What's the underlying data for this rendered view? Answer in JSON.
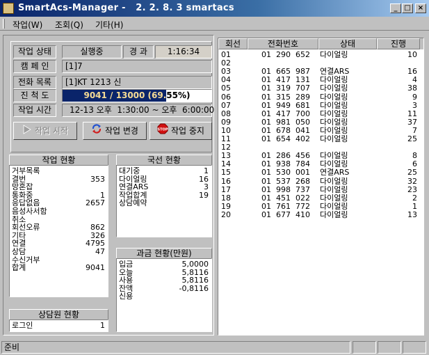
{
  "window": {
    "title": "SmartAcs-Manager -   2. 2. 8. 3 smartacs",
    "minimize": "_",
    "maximize": "□",
    "close": "×"
  },
  "menu": [
    "작업(W)",
    "조회(Q)",
    "기타(H)"
  ],
  "job": {
    "status_label": "작업 상태",
    "status_value": "실행중",
    "elapsed_label": "경 과",
    "elapsed_value": "1:16:34",
    "campaign_label": "캠 페 인",
    "campaign_value": "[1]7",
    "phonelist_label": "전화 목록",
    "phonelist_value": "[1]KT 1213 신",
    "progress_label": "진 척 도",
    "progress_text": "9041 / 13000 (69.55%)",
    "progress_fraction": 0.6955,
    "time_label": "작업 시간",
    "time_value": "12-13 오후  1:30:00 ~ 오후  6:00:00"
  },
  "buttons": {
    "start": "작업 시작",
    "change": "작업 변경",
    "stop": "작업 중지"
  },
  "work_status": {
    "title": "작업 현황",
    "rows": [
      {
        "k": "거부목록",
        "v": ""
      },
      {
        "k": "결번",
        "v": "353"
      },
      {
        "k": "망혼잡",
        "v": ""
      },
      {
        "k": "통화중",
        "v": "1"
      },
      {
        "k": "응답없음",
        "v": "2657"
      },
      {
        "k": "음성사서함",
        "v": ""
      },
      {
        "k": "취소",
        "v": ""
      },
      {
        "k": "회선오류",
        "v": "862"
      },
      {
        "k": "기타",
        "v": "326"
      },
      {
        "k": "연결",
        "v": "4795"
      },
      {
        "k": "상담",
        "v": "47"
      },
      {
        "k": "수신거부",
        "v": ""
      },
      {
        "k": "합계",
        "v": "9041"
      }
    ]
  },
  "agent_status": {
    "title": "상담원 현황",
    "rows": [
      {
        "k": "로그인",
        "v": "1"
      }
    ]
  },
  "line_status": {
    "title": "국선 현황",
    "rows": [
      {
        "k": "대기중",
        "v": "1"
      },
      {
        "k": "다이얼링",
        "v": "16"
      },
      {
        "k": "연결ARS",
        "v": "3"
      },
      {
        "k": "작업합계",
        "v": "19"
      },
      {
        "k": "상담예약",
        "v": ""
      }
    ]
  },
  "billing_status": {
    "title": "과금 현황(만원)",
    "rows": [
      {
        "k": "입금",
        "v": "5,0000"
      },
      {
        "k": "오늘",
        "v": "5,8116"
      },
      {
        "k": "사용",
        "v": "5,8116"
      },
      {
        "k": "잔액",
        "v": "-0,8116"
      },
      {
        "k": "신용",
        "v": ""
      }
    ]
  },
  "table": {
    "headers": [
      "회선",
      "전화번호",
      "상태",
      "진행"
    ],
    "rows": [
      [
        "01",
        "01  290  652",
        "다이얼링",
        "10"
      ],
      [
        "02",
        "",
        "",
        ""
      ],
      [
        "03",
        "01  665  987",
        "연결ARS",
        "16"
      ],
      [
        "04",
        "01  417  131",
        "다이얼링",
        "4"
      ],
      [
        "05",
        "01  319  707",
        "다이얼링",
        "38"
      ],
      [
        "06",
        "01  315  289",
        "다이얼링",
        "9"
      ],
      [
        "07",
        "01  949  681",
        "다이얼링",
        "3"
      ],
      [
        "08",
        "01  417  700",
        "다이얼링",
        "11"
      ],
      [
        "09",
        "01  981  050",
        "다이얼링",
        "37"
      ],
      [
        "10",
        "01  678  041",
        "다이얼링",
        "7"
      ],
      [
        "11",
        "01  654  402",
        "다이얼링",
        "25"
      ],
      [
        "12",
        "",
        "",
        ""
      ],
      [
        "13",
        "01  286  456",
        "다이얼링",
        "8"
      ],
      [
        "14",
        "01  938  784",
        "다이얼링",
        "6"
      ],
      [
        "15",
        "01  530  001",
        "연결ARS",
        "25"
      ],
      [
        "16",
        "01  537  268",
        "다이얼링",
        "32"
      ],
      [
        "17",
        "01  998  737",
        "다이얼링",
        "23"
      ],
      [
        "18",
        "01  451  022",
        "다이얼링",
        "2"
      ],
      [
        "19",
        "01  761  772",
        "다이얼링",
        "1"
      ],
      [
        "20",
        "01  677  410",
        "다이얼링",
        "13"
      ]
    ]
  },
  "statusbar": {
    "text": "준비"
  }
}
